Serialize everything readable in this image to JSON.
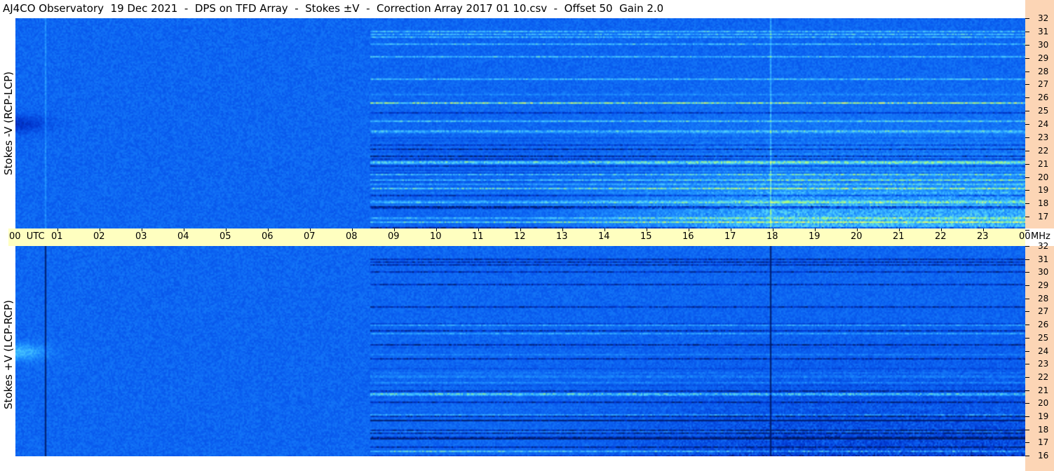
{
  "title": "AJ4CO Observatory  19 Dec 2021  -  DPS on TFD Array  -  Stokes ±V  -  Correction Array 2017 01 10.csv  -  Offset 50  Gain 2.0",
  "panels": [
    {
      "ylabel": "Stokes -V (RCP-LCP)"
    },
    {
      "ylabel": "Stokes +V (LCP-RCP)"
    }
  ],
  "chart_data": {
    "type": "heatmap",
    "title": "AJ4CO Observatory  19 Dec 2021  -  DPS on TFD Array  -  Stokes ±V  -  Correction Array 2017 01 10.csv  -  Offset 50  Gain 2.0",
    "x_axis": {
      "unit": "UTC",
      "range": [
        0,
        24
      ],
      "tick_labels": [
        "00  UTC",
        "01",
        "02",
        "03",
        "04",
        "05",
        "06",
        "07",
        "08",
        "09",
        "10",
        "11",
        "12",
        "13",
        "14",
        "15",
        "16",
        "17",
        "18",
        "19",
        "20",
        "21",
        "22",
        "23",
        "00"
      ]
    },
    "y_axis": {
      "unit": "MHz",
      "range": [
        16,
        32
      ],
      "tick_labels": [
        "32",
        "31",
        "30",
        "29",
        "28",
        "27",
        "26",
        "25",
        "24",
        "23",
        "22",
        "21",
        "20",
        "19",
        "18",
        "17",
        "16"
      ]
    },
    "freq_unit_label": "MHz",
    "colormap": [
      "#001a66",
      "#0033cc",
      "#0a5ef0",
      "#1e90ff",
      "#4fd2ff",
      "#a8ff7a",
      "#ffff66"
    ],
    "series": [
      {
        "name": "Stokes -V (RCP-LCP)"
      },
      {
        "name": "Stokes +V (LCP-RCP)"
      }
    ],
    "grid": false
  },
  "colors": {
    "time_bar": "#ffffc0",
    "freq_bar": "#fcd5b5",
    "background": "#ffffff"
  }
}
